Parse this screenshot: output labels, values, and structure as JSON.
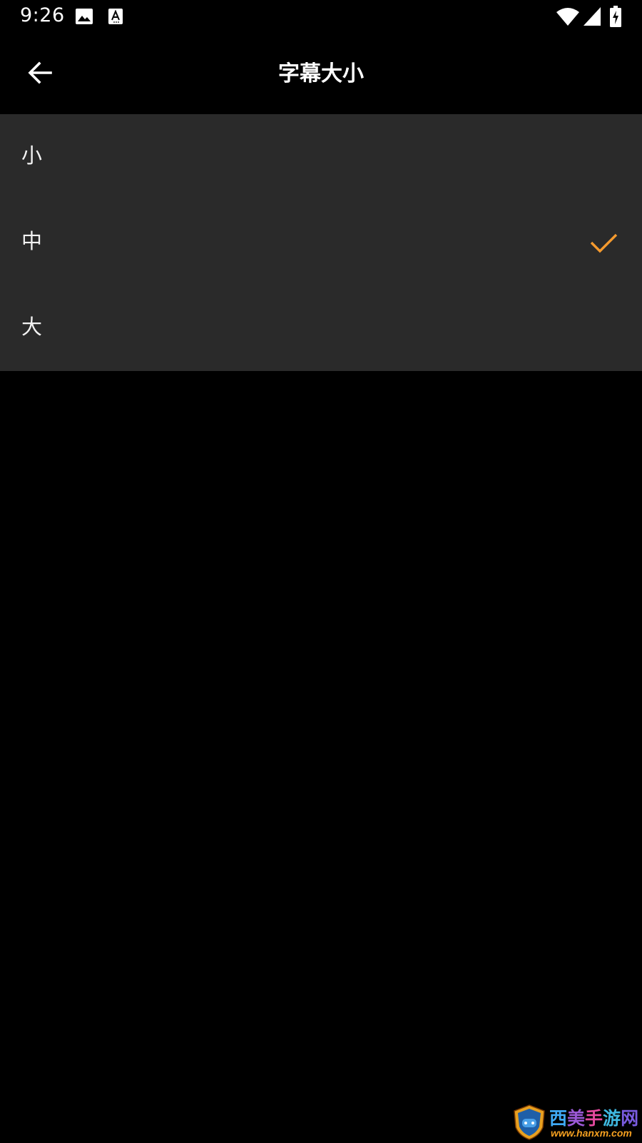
{
  "status_bar": {
    "time": "9:26",
    "left_icons": [
      "image-icon",
      "accessibility-text-icon"
    ],
    "right_icons": [
      "wifi-icon",
      "cellular-signal-icon",
      "battery-charging-icon"
    ]
  },
  "app_bar": {
    "back_icon": "arrow-back-icon",
    "title": "字幕大小"
  },
  "options": [
    {
      "label": "小",
      "selected": false
    },
    {
      "label": "中",
      "selected": true
    },
    {
      "label": "大",
      "selected": false
    }
  ],
  "colors": {
    "background": "#000000",
    "list_background": "#2a2a2a",
    "accent": "#f59a2e",
    "text": "#ffffff"
  },
  "watermark": {
    "text": "西美手游网",
    "url": "www.hanxm.com"
  }
}
